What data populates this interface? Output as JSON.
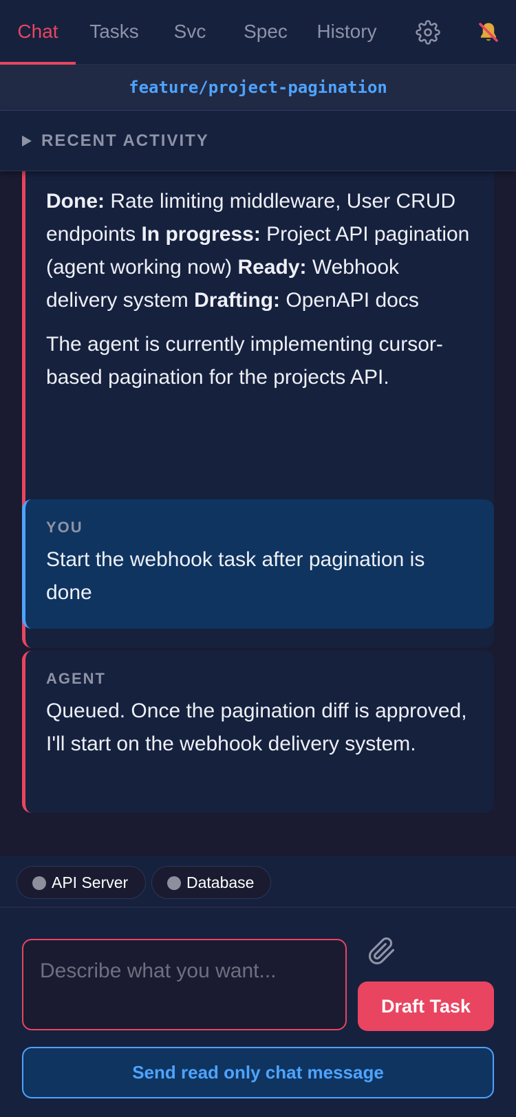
{
  "nav": {
    "tabs": [
      {
        "label": "Chat",
        "active": true
      },
      {
        "label": "Tasks",
        "active": false
      },
      {
        "label": "Svc",
        "active": false
      },
      {
        "label": "Spec",
        "active": false
      },
      {
        "label": "History",
        "active": false
      }
    ],
    "icons": {
      "settings": "gear-icon",
      "notifications": "bell-muted-icon"
    }
  },
  "branch": {
    "name": "feature/project-pagination"
  },
  "recent_activity": {
    "label": "RECENT ACTIVITY",
    "expanded": false
  },
  "messages": [
    {
      "role": "agent",
      "paragraphs": [
        {
          "segments": [
            {
              "bold": true,
              "text": "Done:"
            },
            {
              "bold": false,
              "text": " Rate limiting middleware, User CRUD endpoints "
            },
            {
              "bold": true,
              "text": "In progress:"
            },
            {
              "bold": false,
              "text": " Project API pagination (agent working now) "
            },
            {
              "bold": true,
              "text": "Ready:"
            },
            {
              "bold": false,
              "text": " Webhook delivery system "
            },
            {
              "bold": true,
              "text": "Drafting:"
            },
            {
              "bold": false,
              "text": " OpenAPI docs"
            }
          ]
        },
        {
          "segments": [
            {
              "bold": false,
              "text": "The agent is currently implementing cursor-based pagination for the projects API."
            }
          ]
        }
      ]
    },
    {
      "role": "user",
      "role_label": "YOU",
      "text": "Start the webhook task after pagination is done"
    },
    {
      "role": "agent",
      "role_label": "AGENT",
      "text": "Queued. Once the pagination diff is approved, I'll start on the webhook delivery system."
    }
  ],
  "services": [
    {
      "label": "API Server",
      "status_color": "#8e8e9c"
    },
    {
      "label": "Database",
      "status_color": "#8e8e9c"
    }
  ],
  "composer": {
    "placeholder": "Describe what you want...",
    "value": "",
    "attach_icon": "paperclip-icon",
    "draft_button": "Draft Task",
    "readonly_button": "Send read only chat message"
  },
  "colors": {
    "accent": "#e94560",
    "link_blue": "#4ea3ff",
    "nav_bg": "#16213e",
    "page_bg": "#1a1b30",
    "user_bubble": "#0f3460"
  }
}
